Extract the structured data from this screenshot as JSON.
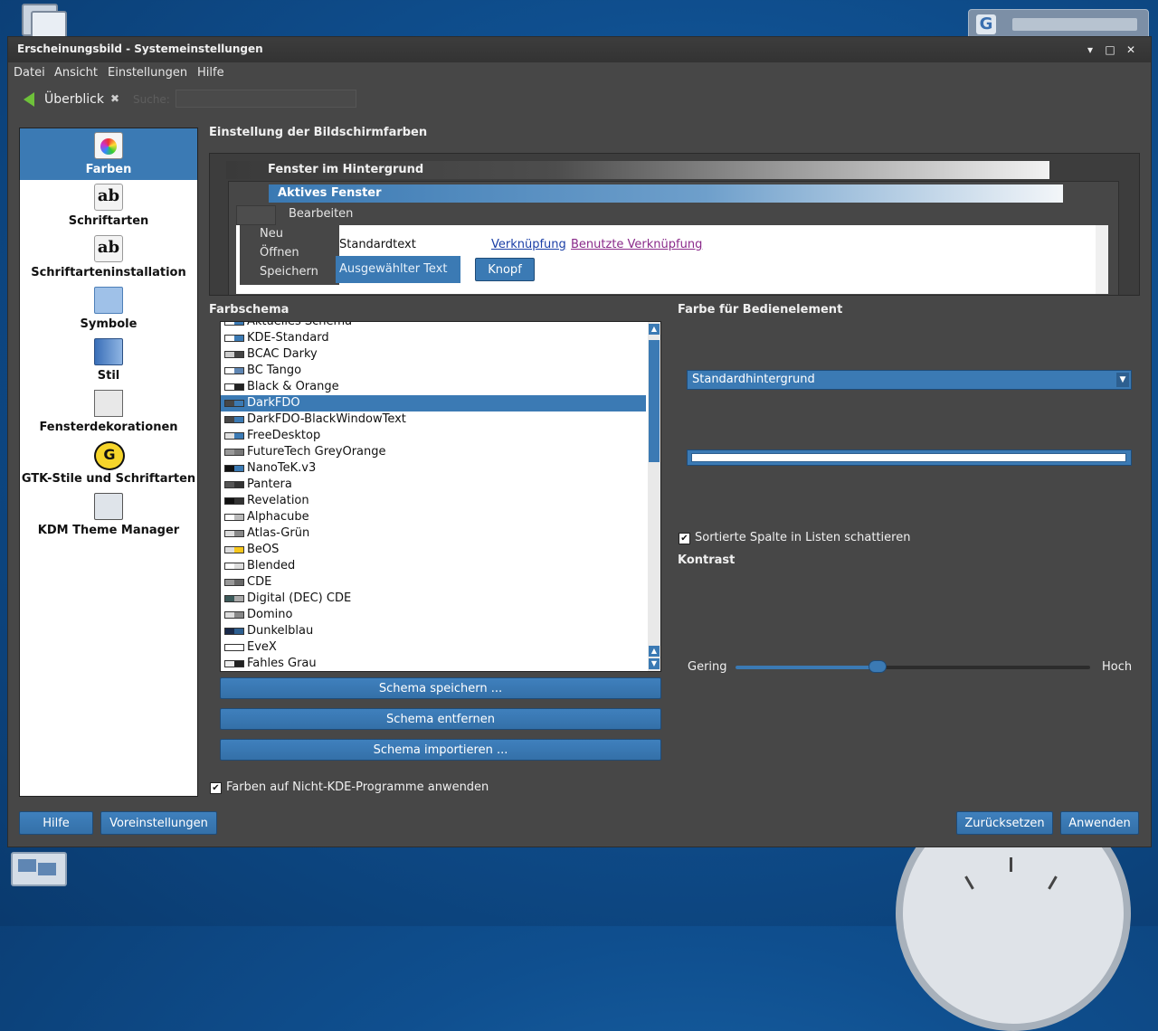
{
  "window": {
    "title": "Erscheinungsbild - Systemeinstellungen",
    "buttons": {
      "help": "▾",
      "maximize": "□",
      "close": "✕"
    }
  },
  "menubar": [
    "Datei",
    "Ansicht",
    "Einstellungen",
    "Hilfe"
  ],
  "toolbar": {
    "back_label": "Überblick",
    "search_label": "Suche:",
    "search_value": ""
  },
  "sidebar": {
    "items": [
      {
        "label": "Farben",
        "icon": "colors-icon",
        "selected": true
      },
      {
        "label": "Schriftarten",
        "icon": "fonts-icon"
      },
      {
        "label": "Schriftarteninstallation",
        "icon": "font-installer-icon"
      },
      {
        "label": "Symbole",
        "icon": "symbols-icon"
      },
      {
        "label": "Stil",
        "icon": "style-icon"
      },
      {
        "label": "Fensterdekorationen",
        "icon": "window-decorations-icon"
      },
      {
        "label": "GTK-Stile und Schriftarten",
        "icon": "gtk-icon"
      },
      {
        "label": "KDM Theme Manager",
        "icon": "kdm-icon"
      }
    ]
  },
  "main": {
    "heading": "Einstellung der Bildschirmfarben",
    "preview": {
      "inactive_title": "Fenster im Hintergrund",
      "active_title": "Aktives Fenster",
      "menu_edit": "Bearbeiten",
      "menu_items": [
        "Neu",
        "Öffnen",
        "Speichern"
      ],
      "standard_text": "Standardtext",
      "selected_text": "Ausgewählter Text",
      "button_label": "Knopf",
      "link": "Verknüpfung",
      "visited_link": "Benutzte Verknüpfung"
    },
    "scheme_label": "Farbschema",
    "schemes": [
      {
        "name": "Aktuelles Schema",
        "colors": [
          "#ffffff",
          "#3b7ab4"
        ]
      },
      {
        "name": "KDE-Standard",
        "colors": [
          "#ffffff",
          "#3b7ab4"
        ]
      },
      {
        "name": "BCAC Darky",
        "colors": [
          "#cccccc",
          "#444444"
        ]
      },
      {
        "name": "BC Tango",
        "colors": [
          "#ffffff",
          "#5f86b3"
        ]
      },
      {
        "name": "Black & Orange",
        "colors": [
          "#ffffff",
          "#222222"
        ]
      },
      {
        "name": "DarkFDO",
        "colors": [
          "#474747",
          "#3b7ab4"
        ],
        "selected": true
      },
      {
        "name": "DarkFDO-BlackWindowText",
        "colors": [
          "#474747",
          "#3b7ab4"
        ]
      },
      {
        "name": "FreeDesktop",
        "colors": [
          "#e0e0e0",
          "#3b7ab4"
        ]
      },
      {
        "name": "FutureTech GreyOrange",
        "colors": [
          "#999999",
          "#777777"
        ]
      },
      {
        "name": "NanoTeK.v3",
        "colors": [
          "#111111",
          "#3b7ab4"
        ]
      },
      {
        "name": "Pantera",
        "colors": [
          "#555555",
          "#333333"
        ]
      },
      {
        "name": "Revelation",
        "colors": [
          "#111111",
          "#333333"
        ]
      },
      {
        "name": "Alphacube",
        "colors": [
          "#ffffff",
          "#bbbbbb"
        ]
      },
      {
        "name": "Atlas-Grün",
        "colors": [
          "#dddddd",
          "#888888"
        ]
      },
      {
        "name": "BeOS",
        "colors": [
          "#dddddd",
          "#f6c61b"
        ]
      },
      {
        "name": "Blended",
        "colors": [
          "#ffffff",
          "#dddddd"
        ]
      },
      {
        "name": "CDE",
        "colors": [
          "#999999",
          "#666666"
        ]
      },
      {
        "name": "Digital (DEC) CDE",
        "colors": [
          "#3c5a5a",
          "#aaaaaa"
        ]
      },
      {
        "name": "Domino",
        "colors": [
          "#dddddd",
          "#888888"
        ]
      },
      {
        "name": "Dunkelblau",
        "colors": [
          "#1a2a4a",
          "#2d5f90"
        ]
      },
      {
        "name": "EveX",
        "colors": [
          "#ffffff",
          "#ffffff"
        ]
      },
      {
        "name": "Fahles Grau",
        "colors": [
          "#eeeeee",
          "#222222"
        ]
      }
    ],
    "buttons": {
      "save": "Schema speichern ...",
      "remove": "Schema entfernen",
      "import": "Schema importieren ..."
    },
    "apply_nonkde": "Farben auf Nicht-KDE-Programme anwenden",
    "apply_nonkde_checked": true
  },
  "right": {
    "color_label": "Farbe für Bedienelement",
    "widget_select": "Standardhintergrund",
    "widget_color": "#ffffff",
    "shade_sorted": "Sortierte Spalte in Listen schattieren",
    "shade_sorted_checked": true,
    "contrast_label": "Kontrast",
    "low_label": "Gering",
    "high_label": "Hoch",
    "contrast_level": 0.4
  },
  "footer": {
    "help": "Hilfe",
    "defaults": "Voreinstellungen",
    "reset": "Zurücksetzen",
    "apply": "Anwenden"
  },
  "colors": {
    "accent": "#3b7ab4",
    "window_bg": "#474747"
  }
}
